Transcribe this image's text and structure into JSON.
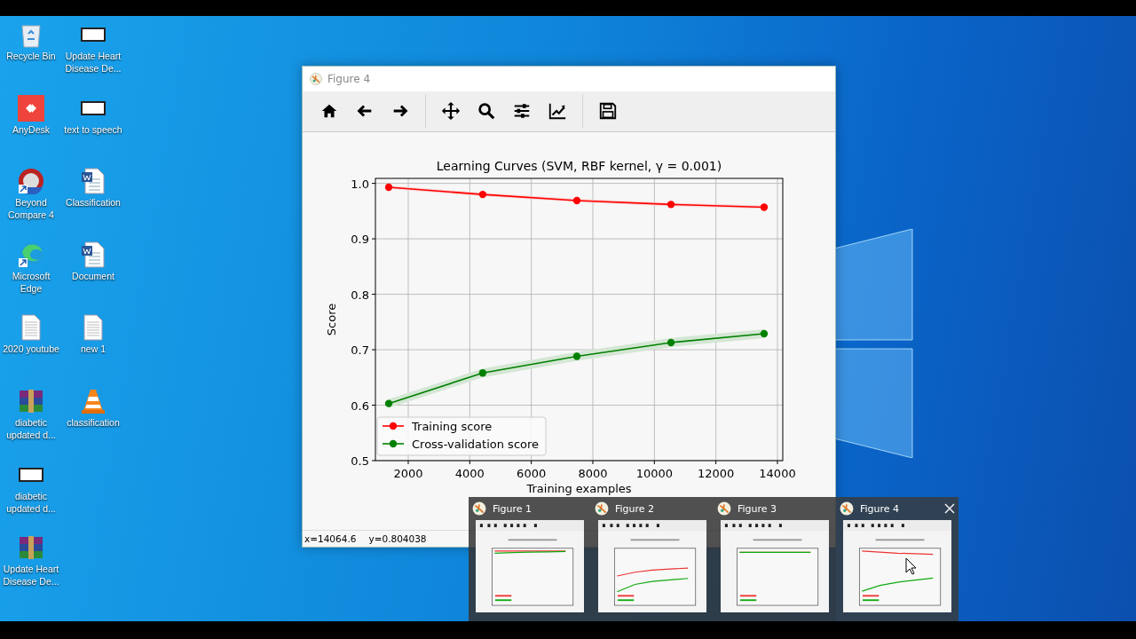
{
  "desktop": {
    "columns": [
      [
        {
          "label": "Recycle Bin",
          "kind": "trash"
        },
        {
          "label": "AnyDesk",
          "kind": "tile"
        },
        {
          "label": "Beyond Compare 4",
          "kind": "disc"
        },
        {
          "label": "Microsoft Edge",
          "kind": "swirl"
        },
        {
          "label": "2020 youtube",
          "kind": "text"
        },
        {
          "label": "diabetic updated d...",
          "kind": "archive"
        },
        {
          "label": "diabetic updated d...",
          "kind": "blank"
        },
        {
          "label": "Update Heart Disease De...",
          "kind": "archive"
        }
      ],
      [
        {
          "label": "Update Heart Disease De...",
          "kind": "blank"
        },
        {
          "label": "text to speech",
          "kind": "blank"
        },
        {
          "label": "Classification",
          "kind": "word"
        },
        {
          "label": "Document",
          "kind": "word"
        },
        {
          "label": "new 1",
          "kind": "text"
        },
        {
          "label": "classification",
          "kind": "cone"
        }
      ]
    ]
  },
  "window": {
    "title": "Figure 4",
    "figure": {
      "chart_data": {
        "type": "line",
        "title": "Learning Curves (SVM, RBF kernel, γ = 0.001)",
        "xlabel": "Training examples",
        "ylabel": "Score",
        "x": [
          1366,
          4420,
          7480,
          10540,
          13566
        ],
        "series": [
          {
            "name": "Training score",
            "color": "#ff0000",
            "marker": "o",
            "values": [
              0.993,
              0.98,
              0.969,
              0.962,
              0.957
            ]
          },
          {
            "name": "Cross-validation score",
            "color": "#008000",
            "marker": "o",
            "values": [
              0.603,
              0.658,
              0.688,
              0.713,
              0.729
            ]
          }
        ],
        "grid": true,
        "legend": true,
        "xlim": [
          933,
          14173
        ],
        "ylim": [
          0.5,
          1.009
        ],
        "xticks": [
          2000,
          4000,
          6000,
          8000,
          10000,
          12000,
          14000
        ],
        "yticks": [
          {
            "value": 0.5,
            "label": "0.5"
          },
          {
            "value": 0.6,
            "label": "0.6"
          },
          {
            "value": 0.7,
            "label": "0.7"
          },
          {
            "value": 0.8,
            "label": "0.8"
          },
          {
            "value": 0.9,
            "label": "0.9"
          },
          {
            "value": 1.0,
            "label": "1.0"
          }
        ]
      }
    },
    "status_bar": {
      "x": "x=14064.6",
      "y": "y=0.804038"
    }
  },
  "taskbar_previews": [
    {
      "title": "Figure 1",
      "selected": false
    },
    {
      "title": "Figure 2",
      "selected": false
    },
    {
      "title": "Figure 3",
      "selected": false
    },
    {
      "title": "Figure 4",
      "selected": true
    }
  ]
}
